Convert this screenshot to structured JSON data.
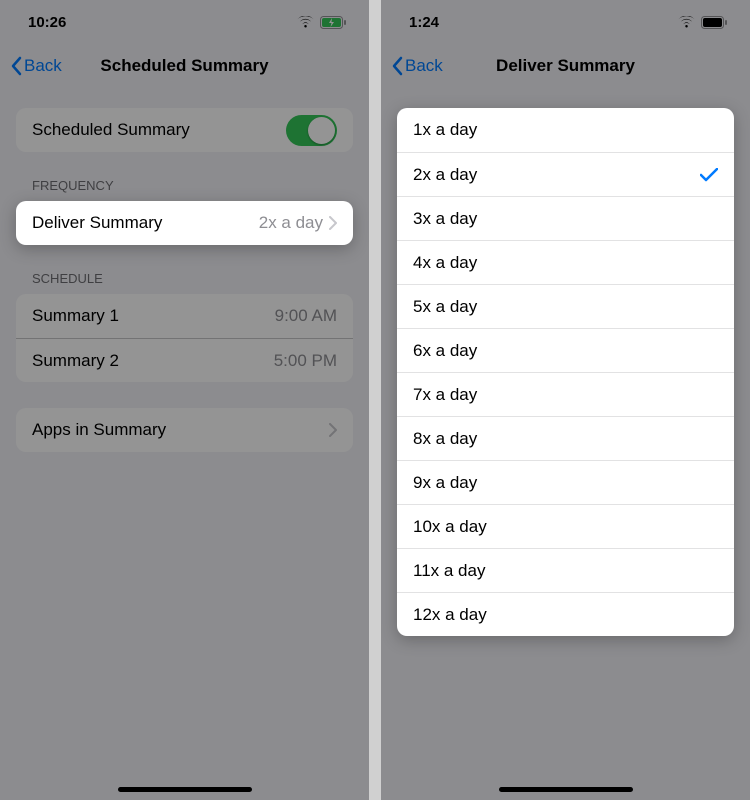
{
  "left": {
    "status": {
      "time": "10:26"
    },
    "nav": {
      "back": "Back",
      "title": "Scheduled Summary"
    },
    "toggle": {
      "label": "Scheduled Summary",
      "on": true
    },
    "frequency": {
      "header": "FREQUENCY",
      "row_label": "Deliver Summary",
      "row_value": "2x a day"
    },
    "schedule": {
      "header": "SCHEDULE",
      "rows": [
        {
          "label": "Summary 1",
          "value": "9:00 AM"
        },
        {
          "label": "Summary 2",
          "value": "5:00 PM"
        }
      ]
    },
    "apps": {
      "label": "Apps in Summary"
    }
  },
  "right": {
    "status": {
      "time": "1:24"
    },
    "nav": {
      "back": "Back",
      "title": "Deliver Summary"
    },
    "options": [
      {
        "label": "1x a day",
        "selected": false
      },
      {
        "label": "2x a day",
        "selected": true
      },
      {
        "label": "3x a day",
        "selected": false
      },
      {
        "label": "4x a day",
        "selected": false
      },
      {
        "label": "5x a day",
        "selected": false
      },
      {
        "label": "6x a day",
        "selected": false
      },
      {
        "label": "7x a day",
        "selected": false
      },
      {
        "label": "8x a day",
        "selected": false
      },
      {
        "label": "9x a day",
        "selected": false
      },
      {
        "label": "10x a day",
        "selected": false
      },
      {
        "label": "11x a day",
        "selected": false
      },
      {
        "label": "12x a day",
        "selected": false
      }
    ]
  }
}
